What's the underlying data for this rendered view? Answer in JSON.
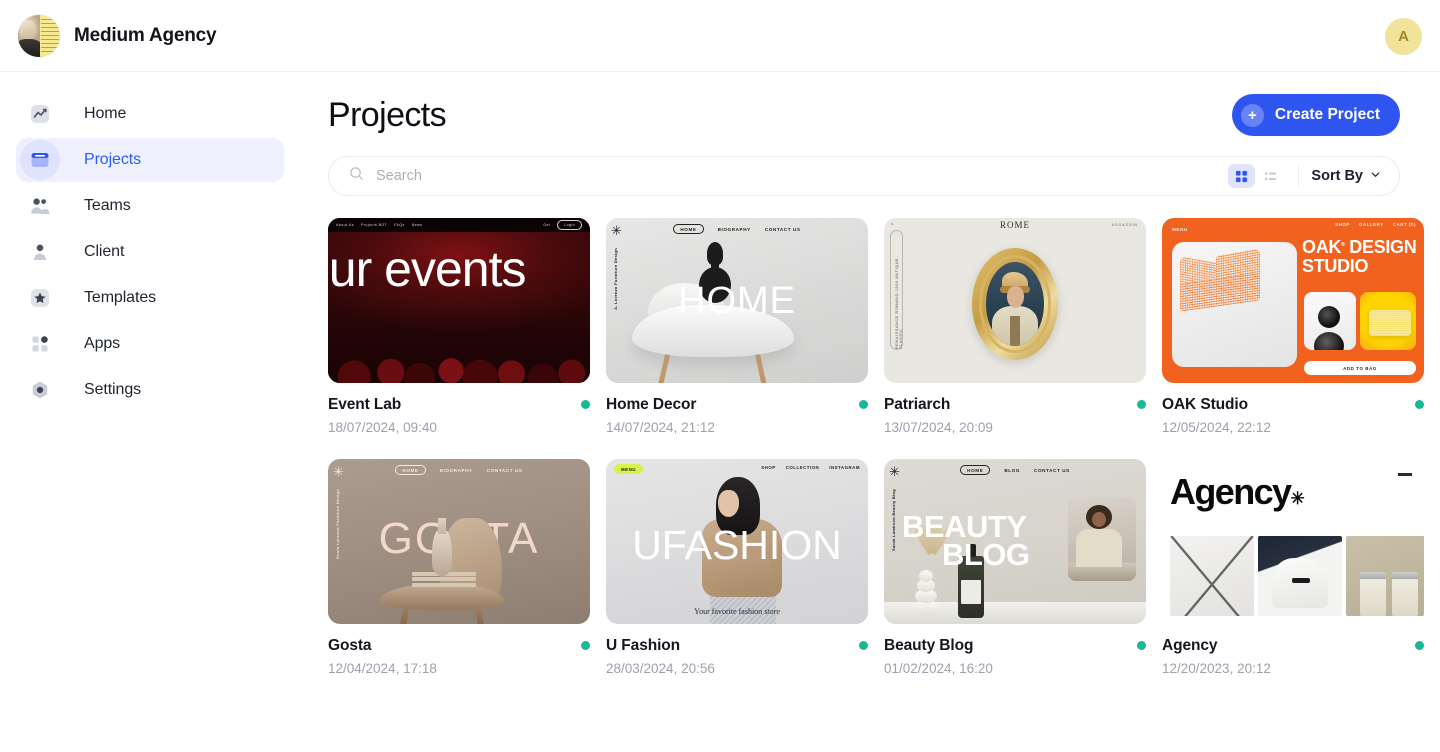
{
  "header": {
    "brand_name": "Medium Agency",
    "brand_avatar_name": "brand-avatar",
    "user_initial": "A"
  },
  "sidebar": {
    "items": [
      {
        "label": "Home",
        "icon": "chart-line-icon",
        "active": false
      },
      {
        "label": "Projects",
        "icon": "projects-board-icon",
        "active": true
      },
      {
        "label": "Teams",
        "icon": "people-icon",
        "active": false
      },
      {
        "label": "Client",
        "icon": "person-icon",
        "active": false
      },
      {
        "label": "Templates",
        "icon": "star-icon",
        "active": false
      },
      {
        "label": "Apps",
        "icon": "grid-apps-icon",
        "active": false
      },
      {
        "label": "Settings",
        "icon": "gear-icon",
        "active": false
      }
    ]
  },
  "main": {
    "title": "Projects",
    "create_button": "Create Project",
    "create_button_plus": "+",
    "search_placeholder": "Search",
    "search_value": "",
    "view_grid_active": true,
    "sort_by_label": "Sort By",
    "accent_color": "#2f55f0",
    "status_color": "#17b897"
  },
  "projects": [
    {
      "name": "Event Lab",
      "date": "18/07/2024, 09:40",
      "status": "active",
      "thumb": {
        "kind": "event",
        "hero": "our events",
        "nav": [
          "About Us",
          "Projects BOT",
          "FAQs",
          "News"
        ],
        "nav_right": [
          "Get",
          "Login"
        ]
      }
    },
    {
      "name": "Home Decor",
      "date": "14/07/2024, 21:12",
      "status": "active",
      "thumb": {
        "kind": "home",
        "hero": "HOME",
        "nav": [
          "HOME",
          "BIOGRAPHY",
          "CONTACT US"
        ],
        "vertical_label": "A. Lorenzo Furniture Design"
      }
    },
    {
      "name": "Patriarch",
      "date": "13/07/2024, 20:09",
      "status": "active",
      "thumb": {
        "kind": "patriarch",
        "title": "ROME",
        "top_right": "ASSASSIN",
        "top_left": "4",
        "vertical_label": "RENAISSANCE ROMANO 1500 ANTIQUE CLASSIC"
      }
    },
    {
      "name": "OAK Studio",
      "date": "12/05/2024, 22:12",
      "status": "active",
      "thumb": {
        "kind": "oak",
        "menu": "MENU",
        "nav_right": [
          "SHOP",
          "GALLERY",
          "CART (0)"
        ],
        "title_line1": "OAK",
        "title_reg": "®",
        "title_line1b": "DESIGN",
        "title_line2": "STUDIO",
        "cta": "ADD TO BAG"
      }
    },
    {
      "name": "Gosta",
      "date": "12/04/2024, 17:18",
      "status": "active",
      "thumb": {
        "kind": "gosta",
        "hero": "GOSTA",
        "nav": [
          "HOME",
          "BIOGRAPHY",
          "CONTACT US"
        ],
        "vertical_label": "Gosta Larsson Furniture Design"
      }
    },
    {
      "name": "U Fashion",
      "date": "28/03/2024, 20:56",
      "status": "active",
      "thumb": {
        "kind": "ufashion",
        "hero": "UFASHION",
        "menu": "MENU",
        "nav_right": [
          "SHOP",
          "COLLECTION",
          "INSTAGRAM"
        ],
        "tagline_plain": "Your favorite fashion ",
        "tagline_italic": "store"
      }
    },
    {
      "name": "Beauty Blog",
      "date": "01/02/2024, 16:20",
      "status": "active",
      "thumb": {
        "kind": "beauty",
        "hero_line1": "BEAUTY",
        "hero_line2": "BLOG",
        "nav": [
          "HOME",
          "BLOG",
          "CONTACT US"
        ],
        "vertical_label": "Sarah Lambson Beauty Blog"
      }
    },
    {
      "name": "Agency",
      "date": "12/20/2023, 20:12",
      "status": "active",
      "thumb": {
        "kind": "agency",
        "title": "Agency",
        "asterisk": "✳"
      }
    }
  ]
}
